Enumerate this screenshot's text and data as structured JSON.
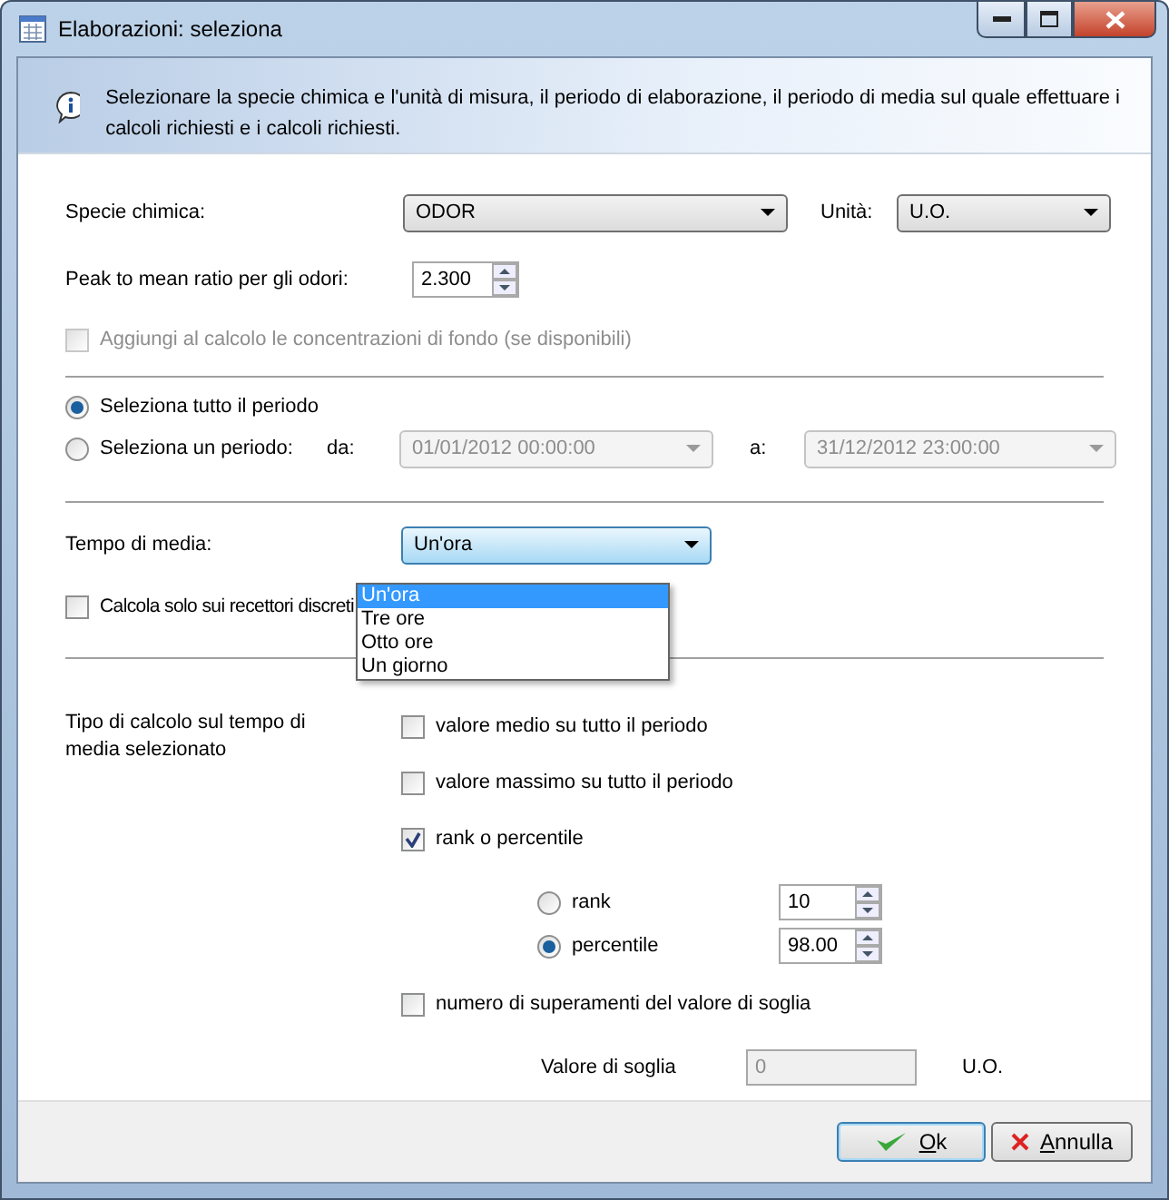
{
  "window": {
    "title": "Elaborazioni: seleziona"
  },
  "info": "Selezionare la specie chimica e l'unità di misura, il periodo di elaborazione, il periodo di media sul quale effettuare i calcoli richiesti e i calcoli richiesti.",
  "species": {
    "label": "Specie chimica:",
    "value": "ODOR"
  },
  "unit": {
    "label": "Unità:",
    "value": "U.O."
  },
  "peak": {
    "label": "Peak to mean ratio per gli odori:",
    "value": "2.300"
  },
  "background": {
    "label": "Aggiungi al calcolo le concentrazioni di fondo (se disponibili)",
    "checked": false,
    "disabled": true
  },
  "period": {
    "options": [
      {
        "label": "Seleziona tutto il periodo",
        "selected": true
      },
      {
        "label": "Seleziona un periodo:",
        "selected": false
      }
    ],
    "from": {
      "label": "da:",
      "value": "01/01/2012 00:00:00",
      "disabled": true
    },
    "to": {
      "label": "a:",
      "value": "31/12/2012 23:00:00",
      "disabled": true
    }
  },
  "averaging": {
    "label": "Tempo di media:",
    "value": "Un'ora",
    "expanded": true,
    "options": [
      {
        "label": "Un'ora",
        "selected": true
      },
      {
        "label": "Tre ore",
        "selected": false
      },
      {
        "label": "Otto ore",
        "selected": false
      },
      {
        "label": "Un giorno",
        "selected": false
      }
    ]
  },
  "discrete": {
    "label": "Calcola solo sui recettori discreti",
    "checked": false
  },
  "calc": {
    "label": "Tipo di calcolo sul tempo di media selezionato",
    "mean": {
      "label": "valore medio su tutto il periodo",
      "checked": false
    },
    "max": {
      "label": "valore massimo su tutto il periodo",
      "checked": false
    },
    "rank_percentile": {
      "label": "rank o percentile",
      "checked": true
    },
    "rank_options": [
      {
        "label": "rank",
        "selected": false,
        "value": "10"
      },
      {
        "label": "percentile",
        "selected": true,
        "value": "98.00"
      }
    ],
    "exceedances": {
      "label": "numero di superamenti del valore di soglia",
      "checked": false
    },
    "threshold": {
      "label": "Valore di soglia",
      "value": "0",
      "unit": "U.O.",
      "disabled": true
    }
  },
  "buttons": [
    {
      "label": "Ok",
      "kind": "ok",
      "default": true
    },
    {
      "label": "Annulla",
      "kind": "cancel",
      "default": false
    }
  ]
}
